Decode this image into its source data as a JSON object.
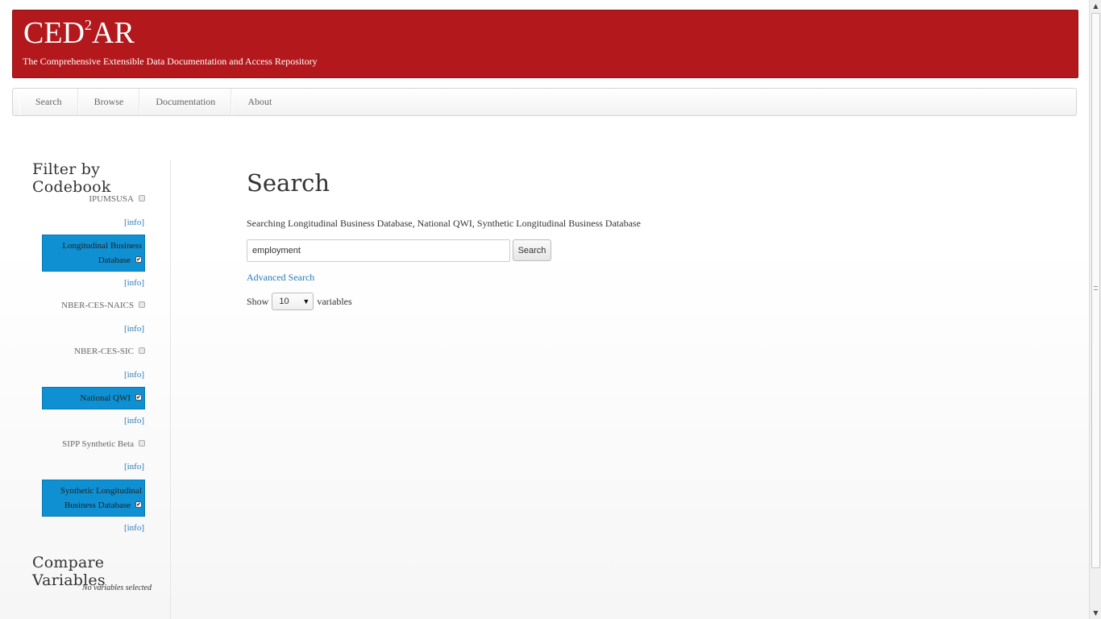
{
  "header": {
    "logo_main": "CED",
    "logo_sup": "2",
    "logo_end": "AR",
    "tagline": "The Comprehensive Extensible Data Documentation and Access Repository"
  },
  "nav": {
    "items": [
      {
        "label": "Search"
      },
      {
        "label": "Browse"
      },
      {
        "label": "Documentation"
      },
      {
        "label": "About"
      }
    ]
  },
  "sidebar": {
    "filter_title": "Filter by Codebook",
    "info_label": "[info]",
    "codebooks": [
      {
        "label": "IPUMSUSA",
        "checked": false
      },
      {
        "label": "Longitudinal Business Database",
        "checked": true
      },
      {
        "label": "NBER-CES-NAICS",
        "checked": false
      },
      {
        "label": "NBER-CES-SIC",
        "checked": false
      },
      {
        "label": "National QWI",
        "checked": true
      },
      {
        "label": "SIPP Synthetic Beta",
        "checked": false
      },
      {
        "label": "Synthetic Longitudinal Business Database",
        "checked": true
      }
    ],
    "compare_title": "Compare Variables",
    "compare_note": "No variables selected"
  },
  "main": {
    "title": "Search",
    "searching_text": "Searching Longitudinal Business Database, National QWI, Synthetic Longitudinal Business Database",
    "search_value": "employment",
    "search_button": "Search",
    "advanced_link": "Advanced Search",
    "show_label": "Show",
    "show_value": "10",
    "variables_label": "variables"
  },
  "colors": {
    "banner": "#b3191c",
    "selected": "#0e90d2",
    "link": "#2a7ab8"
  }
}
